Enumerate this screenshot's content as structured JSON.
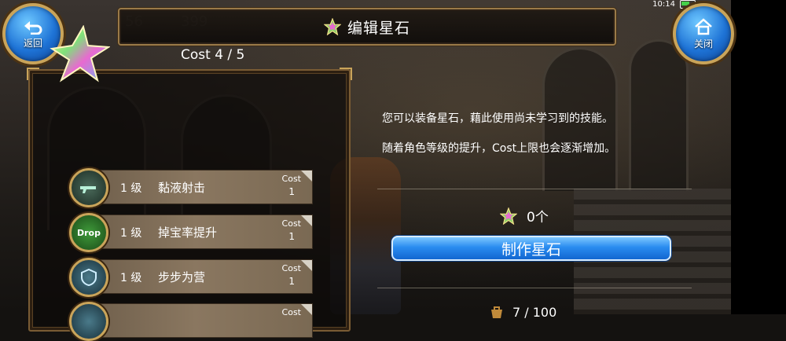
{
  "status_bar": {
    "time": "10:14"
  },
  "hud_background": {
    "value_a": "56",
    "value_b": "399"
  },
  "header": {
    "title": "编辑星石",
    "back_label": "返回",
    "close_label": "关闭"
  },
  "left_panel": {
    "cost_text": "Cost 4 / 5",
    "skills": [
      {
        "level": "1 级",
        "name": "黏液射击",
        "cost_label": "Cost",
        "cost_value": "1",
        "icon": "gun-icon",
        "icon_text": ""
      },
      {
        "level": "1 级",
        "name": "掉宝率提升",
        "cost_label": "Cost",
        "cost_value": "1",
        "icon": "drop-icon",
        "icon_text": "Drop"
      },
      {
        "level": "1 级",
        "name": "步步为营",
        "cost_label": "Cost",
        "cost_value": "1",
        "icon": "shield-icon",
        "icon_text": ""
      },
      {
        "level": "",
        "name": "",
        "cost_label": "Cost",
        "cost_value": "",
        "icon": "skill-icon",
        "icon_text": ""
      }
    ]
  },
  "right_panel": {
    "desc_line1": "您可以装备星石，藉此使用尚未学习到的技能。",
    "desc_line2": "随着角色等级的提升，Cost上限也会逐渐增加。",
    "stone_count": "0个",
    "make_button": "制作星石",
    "bottom_count": "7 / 100"
  },
  "colors": {
    "accent_gold": "#c9a45a",
    "button_blue": "#2a8cf0",
    "panel_border": "#7a5c34"
  }
}
